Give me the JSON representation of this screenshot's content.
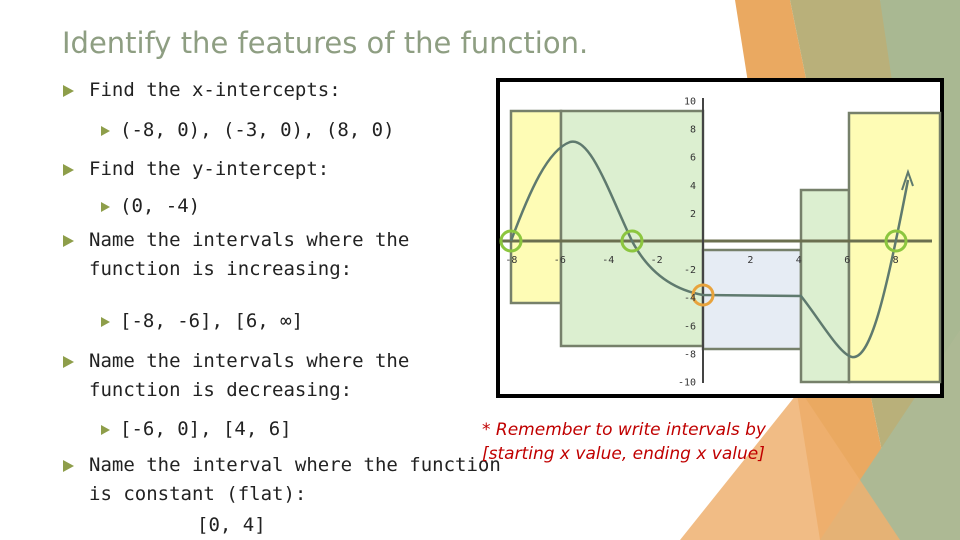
{
  "slide": {
    "title": "Identify the features of the function.",
    "bullets": [
      {
        "text": "Find the x-intercepts:",
        "sub": "(-8, 0), (-3, 0), (8, 0)"
      },
      {
        "text": "Find the y-intercept:",
        "sub": "(0, -4)"
      },
      {
        "text": "Name the intervals where the function is increasing:",
        "sub": "[-8, -6], [6, ∞]"
      },
      {
        "text": "Name the intervals where the function is decreasing:",
        "sub": "[-6, 0], [4, 6]"
      },
      {
        "text": "Name the interval where the function is constant (flat):",
        "sub": "[0, 4]"
      }
    ],
    "note": "* Remember to write intervals by [starting x value, ending x value]"
  },
  "graph": {
    "x_ticks": [
      "-8",
      "-6",
      "-4",
      "-2",
      "2",
      "4",
      "6",
      "8"
    ],
    "y_ticks": [
      "10",
      "8",
      "6",
      "4",
      "2",
      "-2",
      "-4",
      "-6",
      "-8",
      "-10"
    ],
    "colors": {
      "increasing": "#fefcb5",
      "decreasing": "#dcefd0",
      "constant": "#e6ecf4",
      "x_intercept_marker": "#8cc63f",
      "y_intercept_marker": "#e8a33c",
      "curve": "#5f7a6e"
    }
  }
}
